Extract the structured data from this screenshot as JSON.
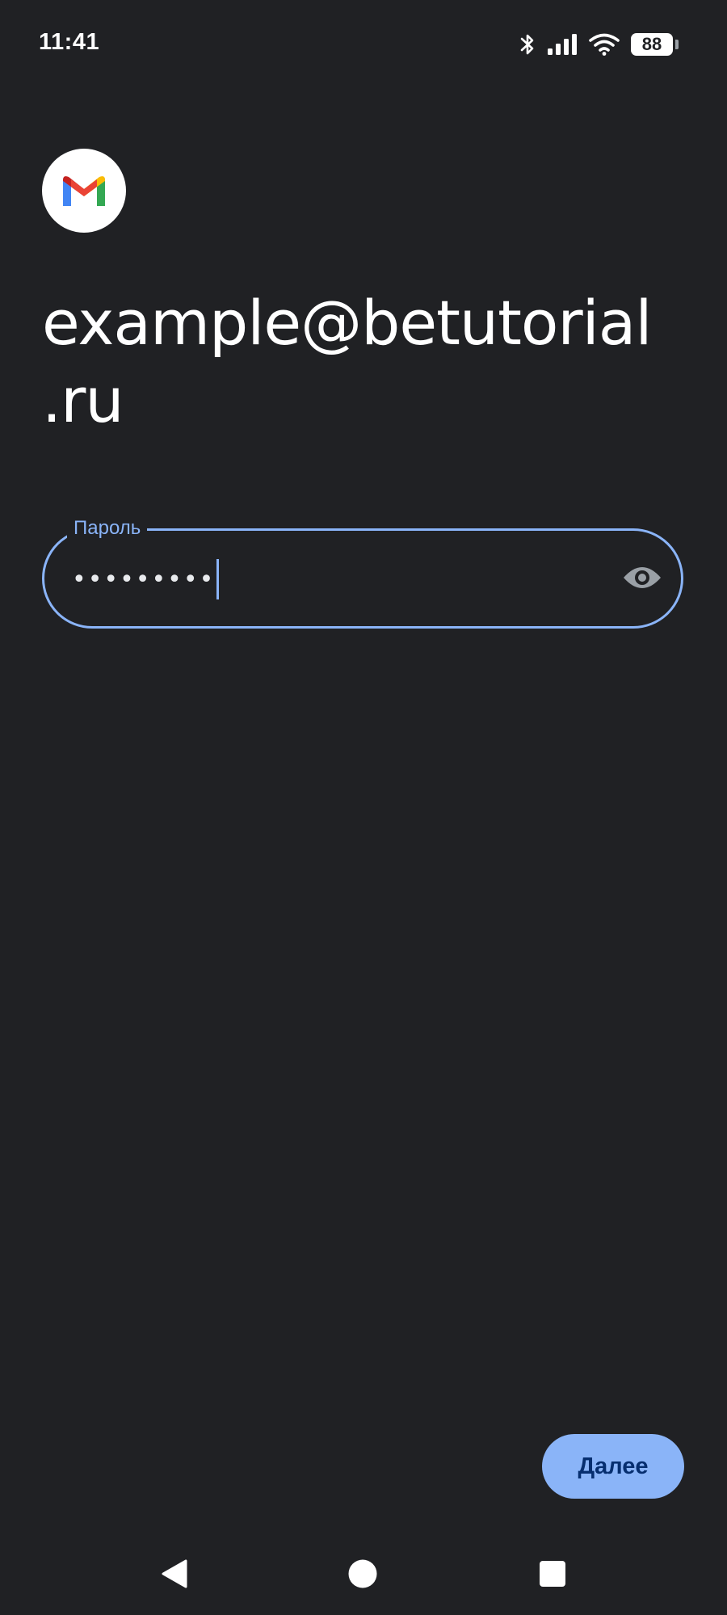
{
  "status_bar": {
    "time": "11:41",
    "battery_level": "88",
    "icons": [
      "bluetooth-icon",
      "signal-icon",
      "wifi-icon",
      "battery-icon"
    ]
  },
  "app": {
    "logo": "gmail-logo-icon",
    "account_email_line1": "example@betutorial",
    "account_email_line2": ".ru"
  },
  "password_field": {
    "label": "Пароль",
    "value": "•••••••••",
    "toggle_icon": "eye-icon"
  },
  "actions": {
    "next_label": "Далее"
  },
  "nav_bar": {
    "icons": [
      "back-icon",
      "home-icon",
      "recents-icon"
    ]
  },
  "colors": {
    "background": "#202124",
    "accent": "#8ab4f8",
    "text": "#ffffff"
  }
}
